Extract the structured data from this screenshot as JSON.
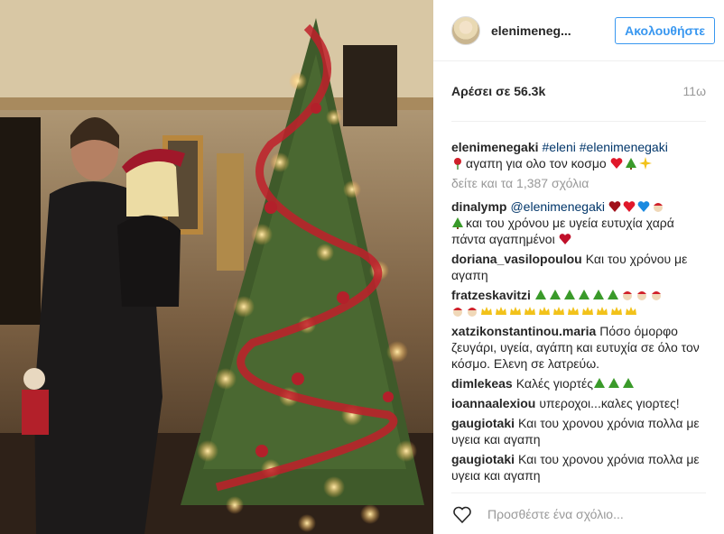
{
  "post": {
    "username": "elenimeneg...",
    "follow_label": "Ακολουθήστε",
    "likes": "Αρέσει σε 56.3k",
    "time": "11ω"
  },
  "caption": {
    "username": "elenimenegaki",
    "tags": "#eleni #elenimenegaki",
    "text": "αγαπη για ολο τον κοσμο",
    "view_all": "δείτε και τα 1,387 σχόλια"
  },
  "comments": [
    {
      "user": "dinalymp",
      "text": "@elenimenegaki",
      "text2": "και του χρόνου με υγεία ευτυχία χαρά πάντα αγαπημένοι"
    },
    {
      "user": "doriana_vasilopoulou",
      "text": "Και του χρόνου με αγαπη"
    },
    {
      "user": "fratzeskavitzi",
      "text": ""
    },
    {
      "user": "xatzikonstantinou.maria",
      "text": "Πόσο όμορφο ζευγάρι, υγεία, αγάπη και ευτυχία σε όλο τον κόσμο. Ελενη σε λατρεύω."
    },
    {
      "user": "dimlekeas",
      "text": "Καλές γιορτές"
    },
    {
      "user": "ioannaalexiou",
      "text": "υπεροχοι...καλες γιορτες!"
    },
    {
      "user": "gaugiotaki",
      "text": "Και του χρονου χρόνια πολλα με υγεια και αγαπη"
    },
    {
      "user": "gaugiotaki",
      "text": "Και του χρονου χρόνια πολλα με υγεια και αγαπη"
    }
  ],
  "add_comment": {
    "placeholder": "Προσθέστε ένα σχόλιο..."
  },
  "icons": {
    "like": "heart-outline-icon",
    "tree": "christmas-tree-icon",
    "santa": "santa-icon",
    "heart": "heart-icon",
    "sparkles": "sparkles-icon",
    "rose": "rose-icon",
    "crown": "crown-icon"
  },
  "colors": {
    "follow": "#3897f0",
    "tag": "#003569",
    "muted": "#999999"
  }
}
